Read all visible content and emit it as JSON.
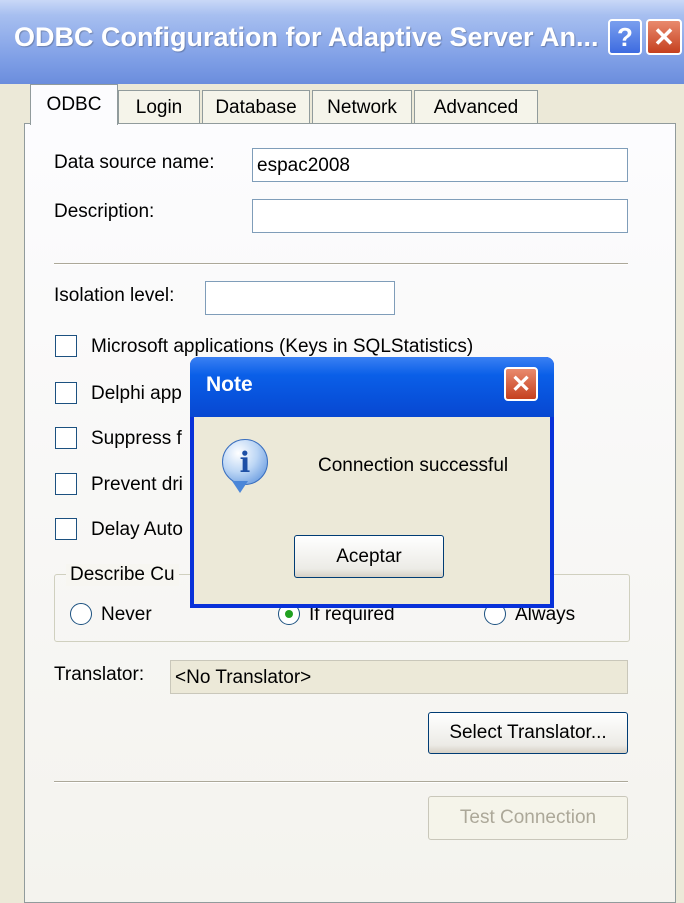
{
  "window": {
    "title": "ODBC Configuration for Adaptive Server An...",
    "help": "?",
    "close": "✕"
  },
  "tabs": [
    "ODBC",
    "Login",
    "Database",
    "Network",
    "Advanced"
  ],
  "form": {
    "dsn_label": "Data source name:",
    "dsn_value": "espac2008",
    "desc_label": "Description:",
    "desc_value": "",
    "isolation_label": "Isolation level:",
    "isolation_value": "",
    "checkboxes": [
      "Microsoft applications (Keys in SQLStatistics)",
      "Delphi app",
      "Suppress f",
      "Prevent dri",
      "Delay Auto"
    ],
    "group_title": "Describe Cu",
    "radios": [
      "Never",
      "If required",
      "Always"
    ],
    "selected_radio": "If required",
    "translator_label": "Translator:",
    "translator_value": "<No Translator>",
    "select_translator_button": "Select Translator...",
    "test_connection_button": "Test Connection"
  },
  "note": {
    "title": "Note",
    "message": "Connection successful",
    "ok_button": "Aceptar",
    "close": "✕",
    "icon_glyph": "i"
  }
}
